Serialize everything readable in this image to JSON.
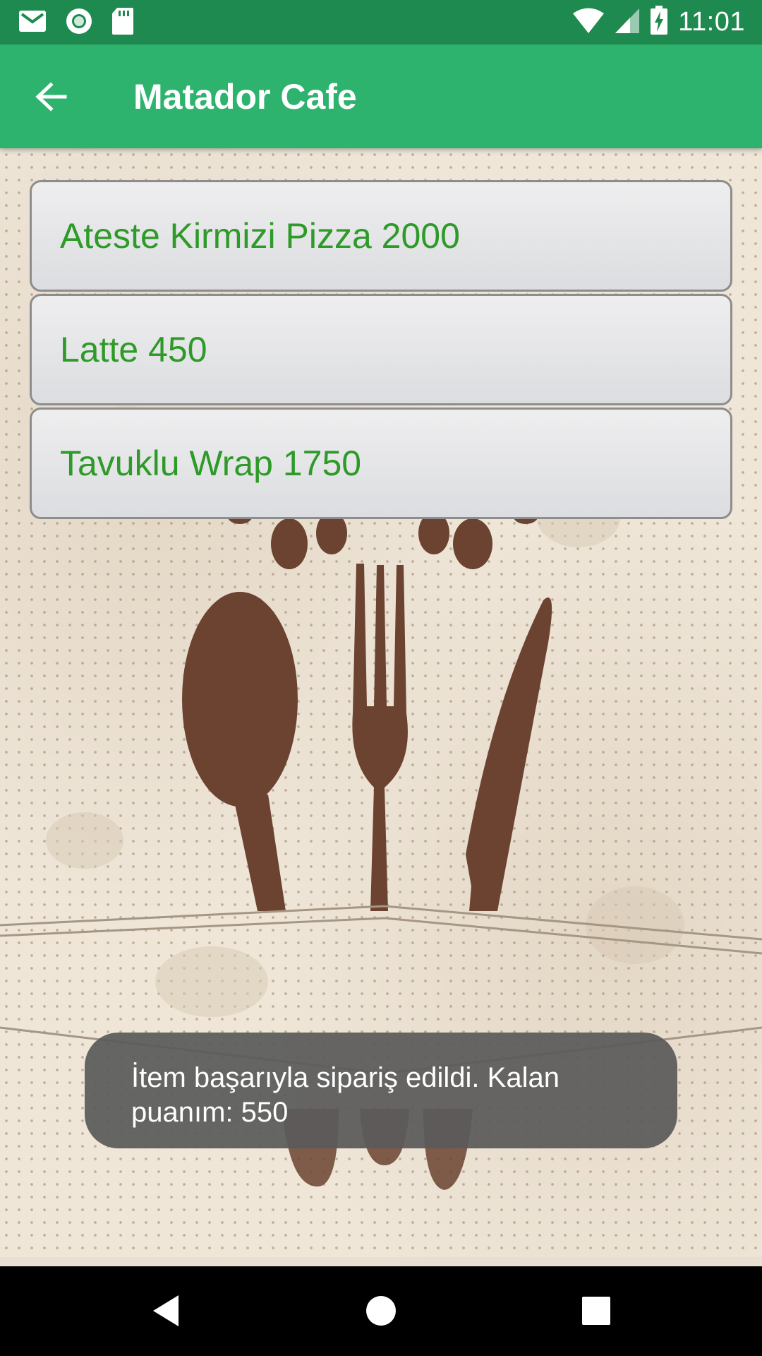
{
  "status_bar": {
    "time": "11:01",
    "left_icons": [
      "gmail-icon",
      "sync-icon",
      "sd-card-icon"
    ],
    "right_icons": [
      "wifi-icon",
      "signal-icon",
      "battery-charging-icon"
    ]
  },
  "app_bar": {
    "title": "Matador Cafe",
    "back_icon": "arrow-back-icon"
  },
  "menu": {
    "items": [
      {
        "label": "Ateste Kirmizi Pizza 2000"
      },
      {
        "label": "Latte 450"
      },
      {
        "label": "Tavuklu Wrap 1750"
      }
    ]
  },
  "toast": {
    "message": "İtem başarıyla sipariş edildi. Kalan puanım: 550"
  },
  "nav_bar": {
    "icons": [
      "back-triangle-icon",
      "home-circle-icon",
      "recents-square-icon"
    ]
  },
  "colors": {
    "status_bar": "#1f8a4f",
    "app_bar": "#2db36e",
    "item_text": "#2e9a28",
    "utensils": "#6b4330"
  }
}
